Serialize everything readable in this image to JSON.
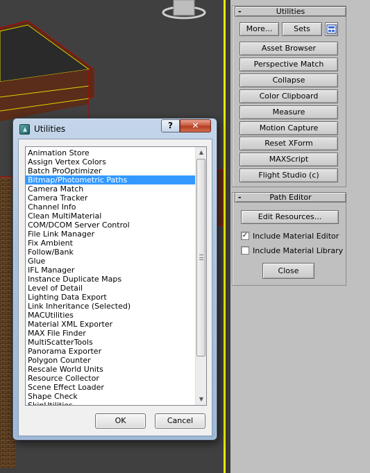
{
  "dialog": {
    "title": "Utilities",
    "help_label": "?",
    "close_label": "✕",
    "items": [
      "Animation Store",
      "Assign Vertex Colors",
      "Batch ProOptimizer",
      "Bitmap/Photometric Paths",
      "Camera Match",
      "Camera Tracker",
      "Channel Info",
      "Clean MultiMaterial",
      "COM/DCOM Server Control",
      "File Link Manager",
      "Fix Ambient",
      "Follow/Bank",
      "Glue",
      "IFL Manager",
      "Instance Duplicate Maps",
      "Level of Detail",
      "Lighting Data Export",
      "Link Inheritance (Selected)",
      "MACUtilities",
      "Material XML Exporter",
      "MAX File Finder",
      "MultiScatterTools",
      "Panorama Exporter",
      "Polygon Counter",
      "Rescale World Units",
      "Resource Collector",
      "Scene Effect Loader",
      "Shape Check",
      "SkinUtilities"
    ],
    "selected_item": "Bitmap/Photometric Paths",
    "ok_label": "OK",
    "cancel_label": "Cancel"
  },
  "utilities_rollout": {
    "sign": "-",
    "title": "Utilities",
    "more_label": "More...",
    "sets_label": "Sets",
    "sets_icon": "configure-sets-icon",
    "buttons": [
      "Asset Browser",
      "Perspective Match",
      "Collapse",
      "Color Clipboard",
      "Measure",
      "Motion Capture",
      "Reset XForm",
      "MAXScript",
      "Flight Studio (c)"
    ]
  },
  "path_editor_rollout": {
    "sign": "-",
    "title": "Path Editor",
    "edit_resources_label": "Edit Resources...",
    "include_material_editor": {
      "label": "Include Material Editor",
      "checked": true
    },
    "include_material_library": {
      "label": "Include Material Library",
      "checked": false
    },
    "close_label": "Close"
  },
  "colors": {
    "viewport_highlight": "#e8e800",
    "selection": "#3399ff",
    "panel_bg": "#c0c0c0"
  }
}
